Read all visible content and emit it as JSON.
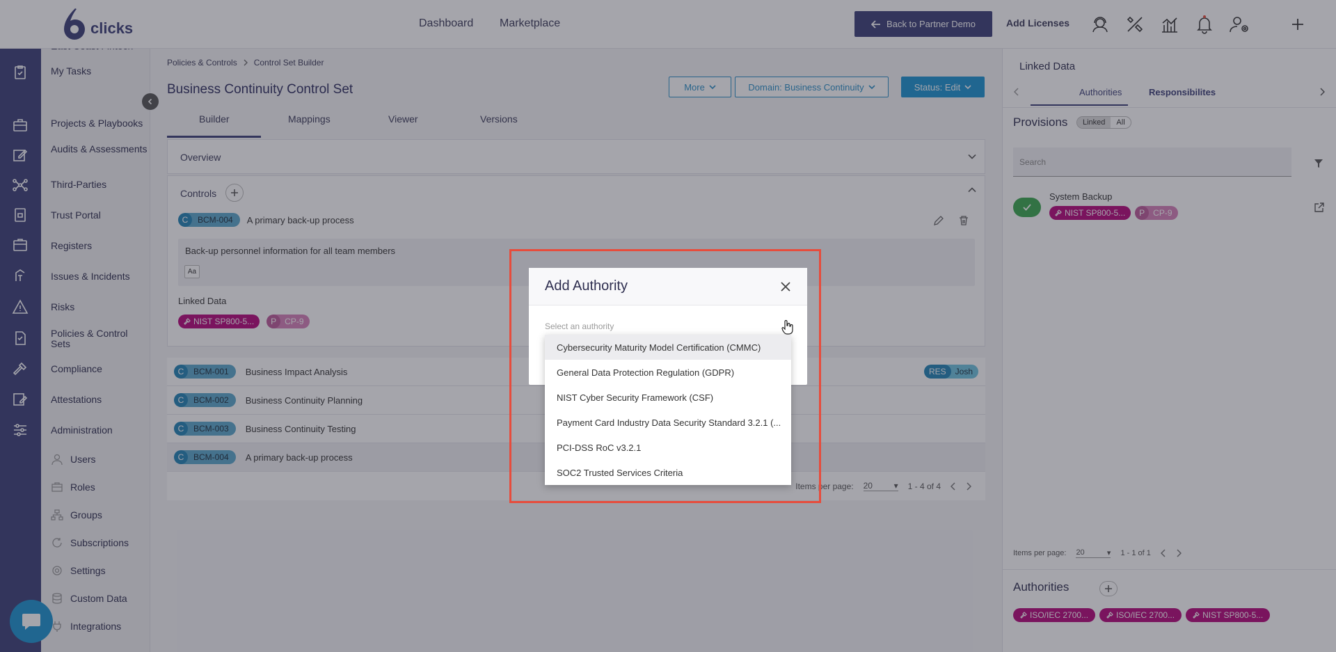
{
  "brand": {
    "name": "clicks",
    "accent": "#3b3f78",
    "link": "#1a93d1"
  },
  "topnav": {
    "dashboard": "Dashboard",
    "marketplace": "Marketplace",
    "back_button": "Back to Partner Demo",
    "add_licenses": "Add Licenses"
  },
  "sidebar": {
    "items": [
      {
        "label": "East Coast Fintech"
      },
      {
        "label": "My Tasks"
      },
      {
        "label": "Projects & Playbooks"
      },
      {
        "label": "Audits & Assessments"
      },
      {
        "label": "Third-Parties"
      },
      {
        "label": "Trust Portal"
      },
      {
        "label": "Registers"
      },
      {
        "label": "Issues & Incidents"
      },
      {
        "label": "Risks"
      },
      {
        "label": "Policies & Control Sets"
      },
      {
        "label": "Compliance"
      },
      {
        "label": "Attestations"
      },
      {
        "label": "Administration"
      }
    ],
    "admin_items": [
      {
        "label": "Users"
      },
      {
        "label": "Roles"
      },
      {
        "label": "Groups"
      },
      {
        "label": "Subscriptions"
      },
      {
        "label": "Settings"
      },
      {
        "label": "Custom Data"
      },
      {
        "label": "Integrations"
      }
    ]
  },
  "breadcrumb": {
    "parent": "Policies & Controls",
    "current": "Control Set Builder"
  },
  "page": {
    "title": "Business Continuity Control Set",
    "more": "More",
    "domain": "Domain: Business Continuity",
    "status": "Status: Edit",
    "tabs": [
      "Builder",
      "Mappings",
      "Viewer",
      "Versions"
    ]
  },
  "overview": {
    "label": "Overview"
  },
  "controls": {
    "label": "Controls",
    "selected": {
      "code": "BCM-004",
      "prefix": "C",
      "title": "A primary back-up process",
      "description": "Back-up personnel information for all team members",
      "format_label": "Aa",
      "linked_label": "Linked Data",
      "tags": [
        {
          "label": "NIST SP800-5..."
        },
        {
          "prefix": "P",
          "label": "CP-9"
        }
      ]
    },
    "rows": [
      {
        "prefix": "C",
        "code": "BCM-001",
        "title": "Business Impact Analysis",
        "role": "RES",
        "owner": "Josh"
      },
      {
        "prefix": "C",
        "code": "BCM-002",
        "title": "Business Continuity Planning"
      },
      {
        "prefix": "C",
        "code": "BCM-003",
        "title": "Business Continuity Testing"
      },
      {
        "prefix": "C",
        "code": "BCM-004",
        "title": "A primary back-up process"
      }
    ],
    "pagination": {
      "label": "Items per page:",
      "per_page": "20",
      "range": "1 - 4 of 4"
    }
  },
  "modal": {
    "title": "Add Authority",
    "placeholder": "Select an authority",
    "options": [
      "Cybersecurity Maturity Model Certification (CMMC)",
      "General Data Protection Regulation (GDPR)",
      "NIST Cyber Security Framework (CSF)",
      "Payment Card Industry Data Security Standard 3.2.1 (...",
      "PCI-DSS RoC v3.2.1",
      "SOC2 Trusted Services Criteria"
    ]
  },
  "right_panel": {
    "title": "Linked Data",
    "tabs": [
      "Authorities",
      "Responsibilites"
    ],
    "provisions_label": "Provisions",
    "seg_linked": "Linked",
    "seg_all": "All",
    "search_placeholder": "Search",
    "provision": {
      "title": "System Backup",
      "tag": "NIST SP800-5...",
      "p_prefix": "P",
      "p_label": "CP-9"
    },
    "pagination": {
      "label": "Items per page:",
      "per_page": "20",
      "range": "1 - 1 of 1"
    },
    "authorities_label": "Authorities",
    "authority_tags": [
      "ISO/IEC 2700...",
      "ISO/IEC 2700...",
      "NIST SP800-5..."
    ]
  }
}
